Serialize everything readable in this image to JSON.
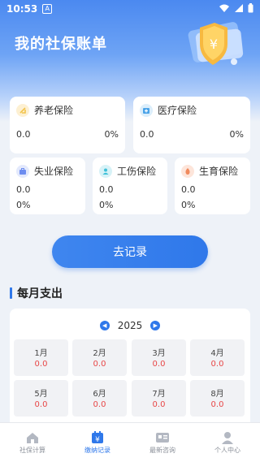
{
  "status": {
    "time": "10:53",
    "badge": "A"
  },
  "header": {
    "title": "我的社保账单"
  },
  "insurance": [
    {
      "name": "养老保险",
      "amount": "0.0",
      "percent": "0%",
      "icon": "pension-icon",
      "color": "#f2c34a"
    },
    {
      "name": "医疗保险",
      "amount": "0.0",
      "percent": "0%",
      "icon": "medical-icon",
      "color": "#4aa3e8"
    },
    {
      "name": "失业保险",
      "amount": "0.0",
      "percent": "0%",
      "icon": "unemployment-icon",
      "color": "#6d8df0"
    },
    {
      "name": "工伤保险",
      "amount": "0.0",
      "percent": "0%",
      "icon": "injury-icon",
      "color": "#3ec0d8"
    },
    {
      "name": "生育保险",
      "amount": "0.0",
      "percent": "0%",
      "icon": "maternity-icon",
      "color": "#f08a5d"
    }
  ],
  "record_button": "去记录",
  "monthly": {
    "title": "每月支出",
    "year": "2025",
    "months": [
      {
        "name": "1月",
        "value": "0.0"
      },
      {
        "name": "2月",
        "value": "0.0"
      },
      {
        "name": "3月",
        "value": "0.0"
      },
      {
        "name": "4月",
        "value": "0.0"
      },
      {
        "name": "5月",
        "value": "0.0"
      },
      {
        "name": "6月",
        "value": "0.0"
      },
      {
        "name": "7月",
        "value": "0.0"
      },
      {
        "name": "8月",
        "value": "0.0"
      }
    ]
  },
  "tabs": [
    {
      "label": "社保计算",
      "icon": "home-icon",
      "active": false
    },
    {
      "label": "缴纳记录",
      "icon": "record-icon",
      "active": true
    },
    {
      "label": "最新咨询",
      "icon": "news-icon",
      "active": false
    },
    {
      "label": "个人中心",
      "icon": "user-icon",
      "active": false
    }
  ],
  "colors": {
    "accent": "#2f78ea",
    "value_red": "#e84747"
  }
}
